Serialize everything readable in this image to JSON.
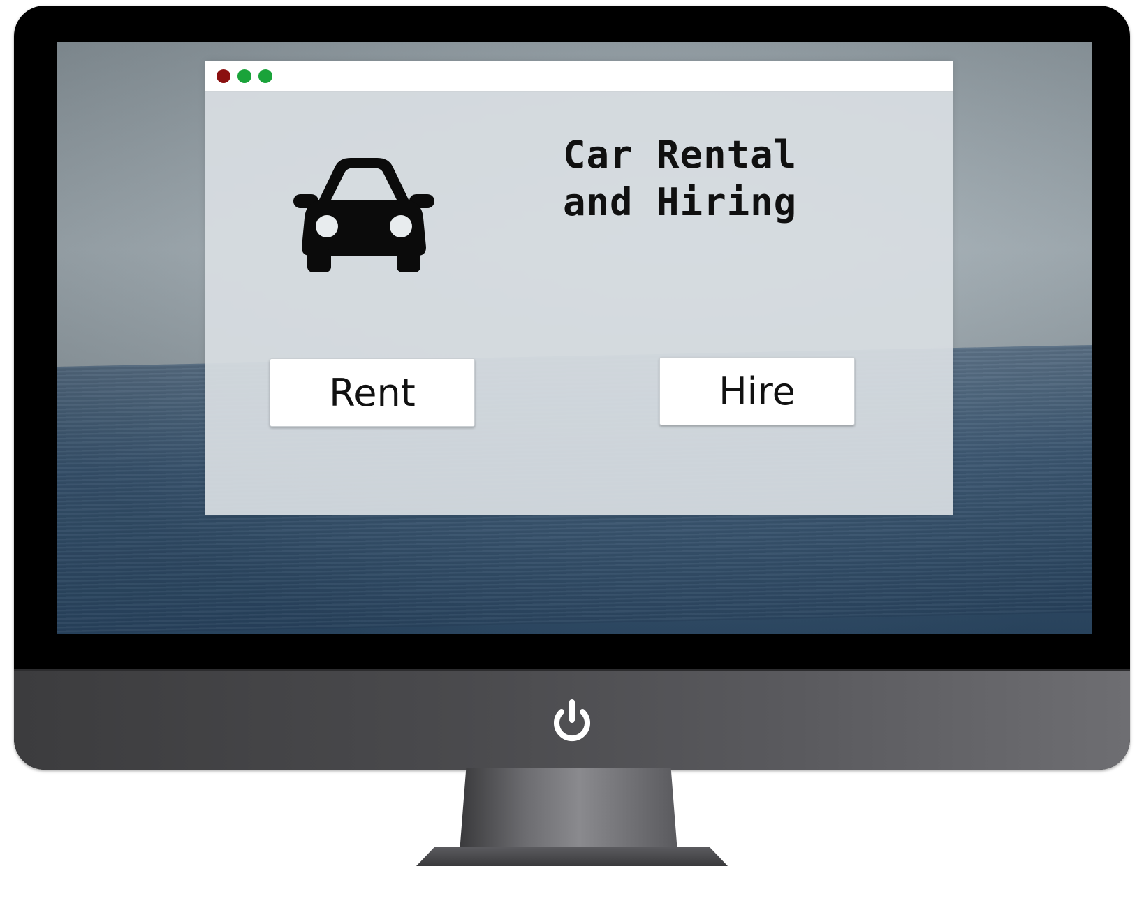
{
  "app": {
    "title_line1": "Car Rental",
    "title_line2": "and Hiring",
    "rent_label": "Rent",
    "hire_label": "Hire",
    "icon": "car-icon"
  },
  "window": {
    "controls": [
      {
        "name": "close",
        "color": "#8b1010"
      },
      {
        "name": "minimize",
        "color": "#1aa33a"
      },
      {
        "name": "maximize",
        "color": "#1aa33a"
      }
    ]
  },
  "device": {
    "power_icon": "power-icon",
    "bezel_color": "#000000",
    "chin_color": "#4a4a4d"
  }
}
